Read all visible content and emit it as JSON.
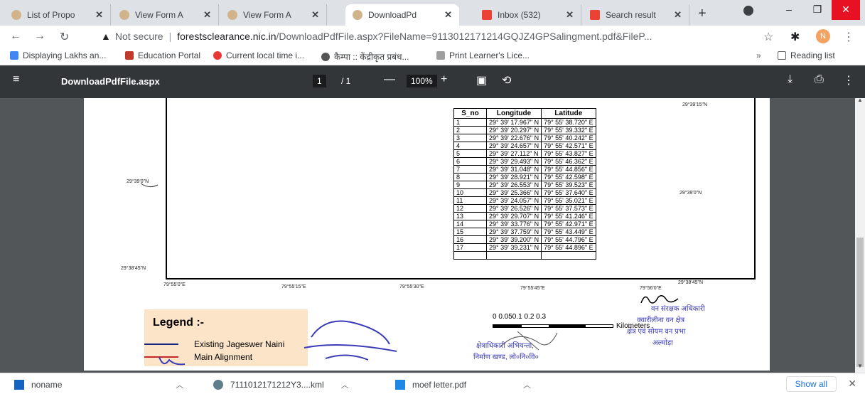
{
  "tabs": [
    {
      "label": "List of Propo",
      "icon": "moef-favicon",
      "color": "#d2b48c"
    },
    {
      "label": "View Form A",
      "icon": "moef-favicon",
      "color": "#d2b48c"
    },
    {
      "label": "View Form A",
      "icon": "moef-favicon",
      "color": "#d2b48c"
    },
    {
      "label": "DownloadPd",
      "icon": "moef-favicon",
      "color": "#d2b48c",
      "active": true
    },
    {
      "label": "Inbox (532)",
      "icon": "gmail-icon",
      "color": "#ea4335"
    },
    {
      "label": "Search result",
      "icon": "gmail-icon",
      "color": "#ea4335"
    }
  ],
  "window": {
    "minimize": "–",
    "maximize": "❐",
    "close": "✕"
  },
  "address": {
    "security": "Not secure",
    "host": "forestsclearance.nic.in",
    "path": "/DownloadPdfFile.aspx?FileName=9113012171214GQJZ4GPSalingment.pdf&FileP...",
    "profile": "N"
  },
  "bookmarks": [
    {
      "label": "Displaying Lakhs an...",
      "color": "#4285f4"
    },
    {
      "label": "Education Portal",
      "color": "#c0392b"
    },
    {
      "label": "Current local time i...",
      "color": "#e53935"
    },
    {
      "label": "कैम्पा :: केंद्रीकृत प्रबंध...",
      "color": "#555555"
    },
    {
      "label": "Print Learner's Lice...",
      "color": "#9e9e9e"
    }
  ],
  "reading_list": "Reading list",
  "pdf": {
    "title": "DownloadPdfFile.aspx",
    "page": "1",
    "total": "/ 1",
    "zoom": "100%"
  },
  "map": {
    "lat_labels": [
      "29°39'15\"N",
      "29°39'0\"N",
      "29°38'45\"N",
      "29°39'0\"N",
      "29°38'45\"N"
    ],
    "lon_labels": [
      "79°55'0\"E",
      "79°55'15\"E",
      "79°55'30\"E",
      "79°55'45\"E",
      "79°56'0\"E"
    ],
    "table_headers": [
      "S_no",
      "Longitude",
      "Latitude"
    ],
    "rows": [
      [
        "1",
        "29° 39' 17.967\" N",
        "79° 55' 38.720\" E"
      ],
      [
        "2",
        "29° 39' 20.297\" N",
        "79° 55' 39.332\" E"
      ],
      [
        "3",
        "29° 39' 22.676\" N",
        "79° 55' 40.242\" E"
      ],
      [
        "4",
        "29° 39' 24.657\" N",
        "79° 55' 42.571\" E"
      ],
      [
        "5",
        "29° 39' 27.112\" N",
        "79° 55' 43.827\" E"
      ],
      [
        "6",
        "29° 39' 29.493\" N",
        "79° 55' 46.362\" E"
      ],
      [
        "7",
        "29° 39' 31.048\" N",
        "79° 55' 44.856\" E"
      ],
      [
        "8",
        "29° 39' 28.921\" N",
        "79° 55' 42.598\" E"
      ],
      [
        "9",
        "29° 39' 26.553\" N",
        "79° 55' 39.523\" E"
      ],
      [
        "10",
        "29° 39' 25.366\" N",
        "79° 55' 37.640\" E"
      ],
      [
        "11",
        "29° 39' 24.057\" N",
        "79° 55' 35.021\" E"
      ],
      [
        "12",
        "29° 39' 26.526\" N",
        "79° 55' 37.573\" E"
      ],
      [
        "13",
        "29° 39' 29.707\" N",
        "79° 55' 41.246\" E"
      ],
      [
        "14",
        "29° 39' 33.776\" N",
        "79° 55' 42.971\" E"
      ],
      [
        "15",
        "29° 39' 37.759\" N",
        "79° 55' 43.449\" E"
      ],
      [
        "16",
        "29° 39' 39.200\" N",
        "79° 55' 44.796\" E"
      ],
      [
        "17",
        "29° 39' 39.231\" N",
        "79° 55' 44.896\" E"
      ]
    ],
    "legend_title": "Legend :-",
    "legend_items": [
      {
        "label": "Existing Jageswer Naini",
        "color": "#1a237e"
      },
      {
        "label": "Main Alignment",
        "color": "#c62828"
      }
    ],
    "scale_ticks": "0 0.050.1   0.2    0.3",
    "scale_unit": "Kilometers",
    "stamp_text_1": "वन संरक्षक अधिकारी",
    "stamp_text_2": "क्वारीलीना वन क्षेत्र",
    "stamp_text_3": "क्षेत्र एवं सोयम वन प्रभा",
    "stamp_text_4": "अल्मोड़ा",
    "stamp_text_5": "क्षेत्राधिकारी अभियन्ता,",
    "stamp_text_6": "निर्माण खण्ड, लो०नि०वि०"
  },
  "downloads": [
    {
      "label": "noname",
      "color": "#1565c0"
    },
    {
      "label": "7111012171212Y3....kml",
      "color": "#607d8b"
    },
    {
      "label": "moef letter.pdf",
      "color": "#1e88e5"
    }
  ],
  "show_all": "Show all"
}
